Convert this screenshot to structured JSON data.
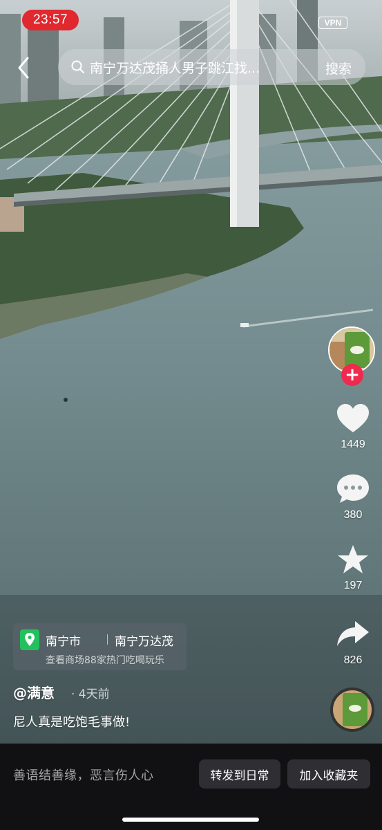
{
  "status_bar": {
    "time": "23:57",
    "vpn": "VPN"
  },
  "search": {
    "query": "南宁万达茂捅人男子跳江找...",
    "button": "搜索"
  },
  "rail": {
    "likes": "1449",
    "comments": "380",
    "favorites": "197",
    "shares": "826",
    "follow_icon": "plus-icon"
  },
  "location": {
    "city": "南宁市",
    "place": "南宁万达茂",
    "subtitle": "查看商场88家热门吃喝玩乐"
  },
  "post": {
    "author": "@满意",
    "time_ago": "· 4天前",
    "caption": "尼人真是吃饱毛事做!"
  },
  "bottom": {
    "comment_hint": "善语结善缘，恶言伤人心",
    "repost_button": "转发到日常",
    "favorite_button": "加入收藏夹"
  },
  "colors": {
    "accent": "#f0294e",
    "time_pill": "#e0282e",
    "location_pin": "#22c15e",
    "bottom_bg": "#111114"
  }
}
